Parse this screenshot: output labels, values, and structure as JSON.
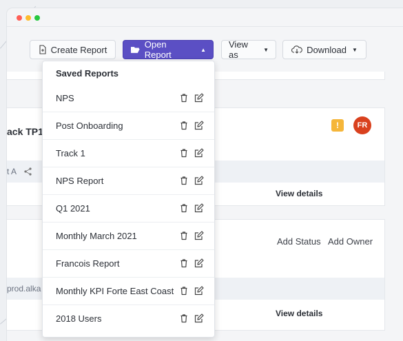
{
  "toolbar": {
    "create_report": "Create Report",
    "open_report": "Open Report",
    "view_as": "View as",
    "download": "Download"
  },
  "card1": {
    "title_fragment": "ack TP1",
    "alert_badge": "!",
    "avatar_initials": "FR",
    "meta_fragment": "t A",
    "view_details": "View details"
  },
  "card2": {
    "add_status": "Add Status",
    "add_owner": "Add Owner",
    "url_fragment": "prod.alka",
    "view_details": "View details"
  },
  "dropdown": {
    "header": "Saved Reports",
    "items": [
      {
        "label": "NPS"
      },
      {
        "label": "Post Onboarding"
      },
      {
        "label": "Track 1"
      },
      {
        "label": "NPS Report"
      },
      {
        "label": "Q1 2021"
      },
      {
        "label": "Monthly March 2021"
      },
      {
        "label": "Francois Report"
      },
      {
        "label": "Monthly KPI Forte East Coast"
      },
      {
        "label": "2018 Users"
      }
    ]
  },
  "colors": {
    "primary": "#5b4fc4",
    "avatar": "#d9411e",
    "alert": "#f5b63a",
    "traffic_red": "#ff5f57",
    "traffic_yellow": "#febc2e",
    "traffic_green": "#28c840"
  },
  "icons": {
    "create_report": "document-plus-icon",
    "open_report": "folder-open-icon",
    "download": "cloud-download-icon",
    "delete": "trash-icon",
    "edit": "edit-icon"
  }
}
